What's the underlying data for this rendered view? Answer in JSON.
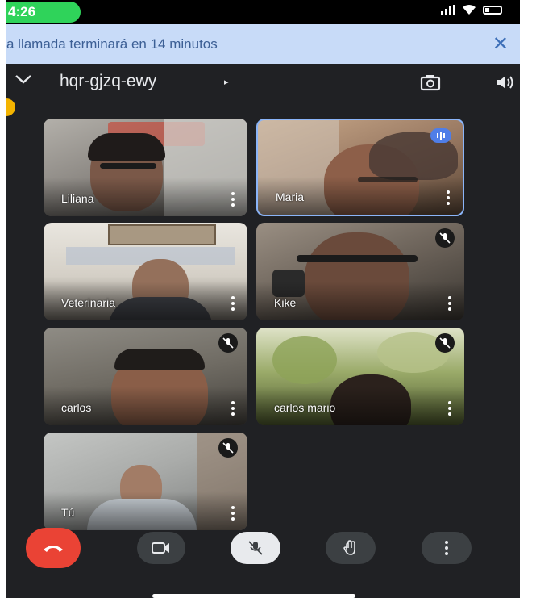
{
  "status_bar": {
    "time": "4:26"
  },
  "banner": {
    "text": "a llamada terminará en 14 minutos",
    "close_label": "✕"
  },
  "header": {
    "meeting_code": "hqr-gjzq-ewy",
    "code_arrow": "▸",
    "collapse_icon": "chevron-down-icon",
    "camera_switch_icon": "switch-camera-icon",
    "speaker_icon": "speaker-icon"
  },
  "participants": [
    {
      "name": "Liliana",
      "muted": false,
      "speaking": false
    },
    {
      "name": "Maria",
      "muted": false,
      "speaking": true
    },
    {
      "name": "Veterinaria",
      "muted": false,
      "speaking": false
    },
    {
      "name": "Kike",
      "muted": true,
      "speaking": false
    },
    {
      "name": "carlos",
      "muted": true,
      "speaking": false
    },
    {
      "name": "carlos mario",
      "muted": true,
      "speaking": false
    },
    {
      "name": "Tú",
      "muted": true,
      "speaking": false
    }
  ],
  "controls": {
    "end_call_icon": "end-call-icon",
    "camera_icon": "camera-icon",
    "mic_icon": "mic-off-icon",
    "raise_hand_icon": "raise-hand-icon",
    "more_icon": "more-options-icon"
  },
  "colors": {
    "background": "#202124",
    "end_call": "#ea4335",
    "banner": "#c8dbf8",
    "active_speaker": "#4f7ee8",
    "status_pill": "#2fd35a"
  }
}
